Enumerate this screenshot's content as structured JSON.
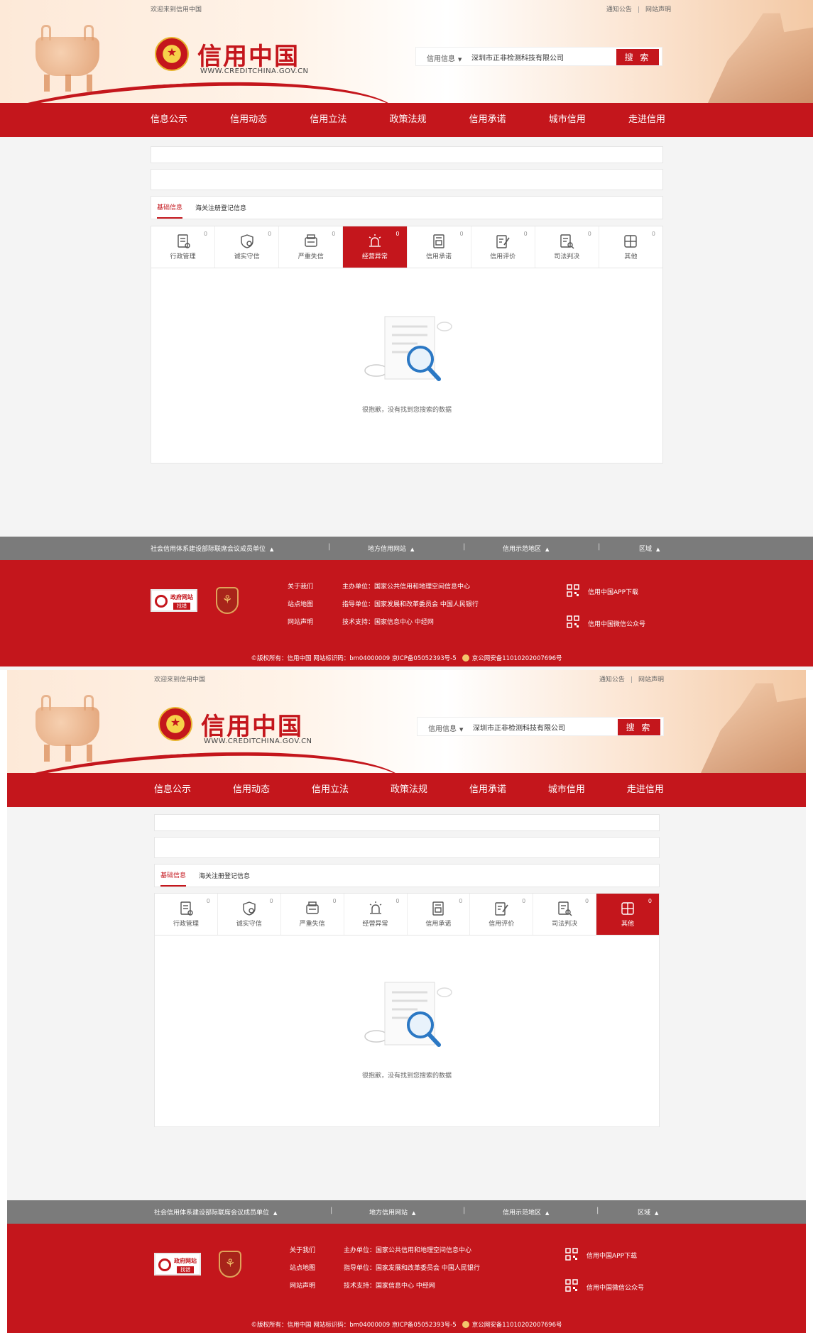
{
  "site": {
    "welcome": "欢迎来到信用中国",
    "top_links": [
      "通知公告",
      "网站声明"
    ],
    "logo_title": "信用中国",
    "logo_sub": "WWW.CREDITCHINA.GOV.CN",
    "search": {
      "category": "信用信息",
      "value": "深圳市正非检测科技有限公司",
      "button": "搜 索"
    },
    "nav": [
      "信息公示",
      "信用动态",
      "信用立法",
      "政策法规",
      "信用承诺",
      "城市信用",
      "走进信用"
    ],
    "tabs": [
      "基础信息",
      "海关注册登记信息"
    ],
    "categories": [
      {
        "label": "行政管理",
        "count": "0",
        "icon": "admin-doc-icon"
      },
      {
        "label": "诚实守信",
        "count": "0",
        "icon": "shield-icon"
      },
      {
        "label": "严重失信",
        "count": "0",
        "icon": "blacklist-icon"
      },
      {
        "label": "经营异常",
        "count": "0",
        "icon": "alarm-icon"
      },
      {
        "label": "信用承诺",
        "count": "0",
        "icon": "promise-icon"
      },
      {
        "label": "信用评价",
        "count": "0",
        "icon": "evaluate-icon"
      },
      {
        "label": "司法判决",
        "count": "0",
        "icon": "judgment-icon"
      },
      {
        "label": "其他",
        "count": "0",
        "icon": "other-icon"
      }
    ],
    "empty_text": "很抱歉，没有找到您搜索的数据",
    "footer_gray": [
      "社会信用体系建设部际联席会议成员单位",
      "地方信用网站",
      "信用示范地区",
      "区域"
    ],
    "footer_links": [
      "关于我们",
      "站点地图",
      "网站声明"
    ],
    "footer_info": [
      "主办单位：国家公共信用和地理空间信息中心",
      "指导单位：国家发展和改革委员会 中国人民银行",
      "技术支持：国家信息中心 中经网"
    ],
    "gov_badge": [
      "政府网站",
      "找错"
    ],
    "qr_labels": [
      "信用中国APP下载",
      "信用中国微信公众号"
    ],
    "copyright": "©版权所有：信用中国    网站标识码：bm04000009    京ICP备05052393号-5",
    "police_record": "京公网安备11010202007696号",
    "colors": {
      "brand_red": "#c4161c",
      "footer_gray": "#7b7b7b"
    }
  },
  "screens": [
    {
      "active_category": "经营异常"
    },
    {
      "active_category": "其他"
    }
  ]
}
